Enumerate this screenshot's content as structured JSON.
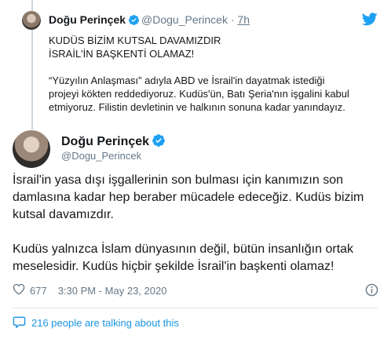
{
  "quoted_tweet": {
    "author_name": "Doğu Perinçek",
    "handle": "@Dogu_Perincek",
    "separator": "·",
    "time": "7h",
    "lines": [
      "KUDÜS BİZİM KUTSAL DAVAMIZDIR",
      "İSRAİL'İN BAŞKENTİ OLAMAZ!",
      "",
      "“Yüzyılın Anlaşması” adıyla ABD ve İsrail'in dayatmak istediği",
      "projeyi kökten reddediyoruz. Kudüs'ün, Batı Şeria'nın işgalini kabul",
      "etmiyoruz. Filistin devletinin ve halkının sonuna kadar yanındayız."
    ]
  },
  "main_tweet": {
    "author_name": "Doğu Perinçek",
    "handle": "@Dogu_Perincek",
    "lines": [
      "İsrail'in yasa dışı işgallerinin son bulması için kanımızın son",
      "damlasına kadar hep beraber mücadele edeceğiz. Kudüs bizim",
      "kutsal davamızdır.",
      "",
      "Kudüs yalnızca İslam dünyasının değil, bütün insanlığın ortak",
      "meselesidir. Kudüs hiçbir şekilde İsrail'in başkenti olamaz!"
    ],
    "like_count": "677",
    "timestamp": "3:30 PM - May 23, 2020",
    "talking_text": "216 people are talking about this"
  },
  "colors": {
    "verified": "#1da1f2",
    "link": "#1b95e0",
    "muted": "#657786",
    "text": "#14171a"
  },
  "icons": {
    "verified": "verified-badge-icon",
    "brand": "twitter-bird-icon",
    "like": "heart-icon",
    "info": "info-icon",
    "talking": "comment-bubble-icon"
  }
}
